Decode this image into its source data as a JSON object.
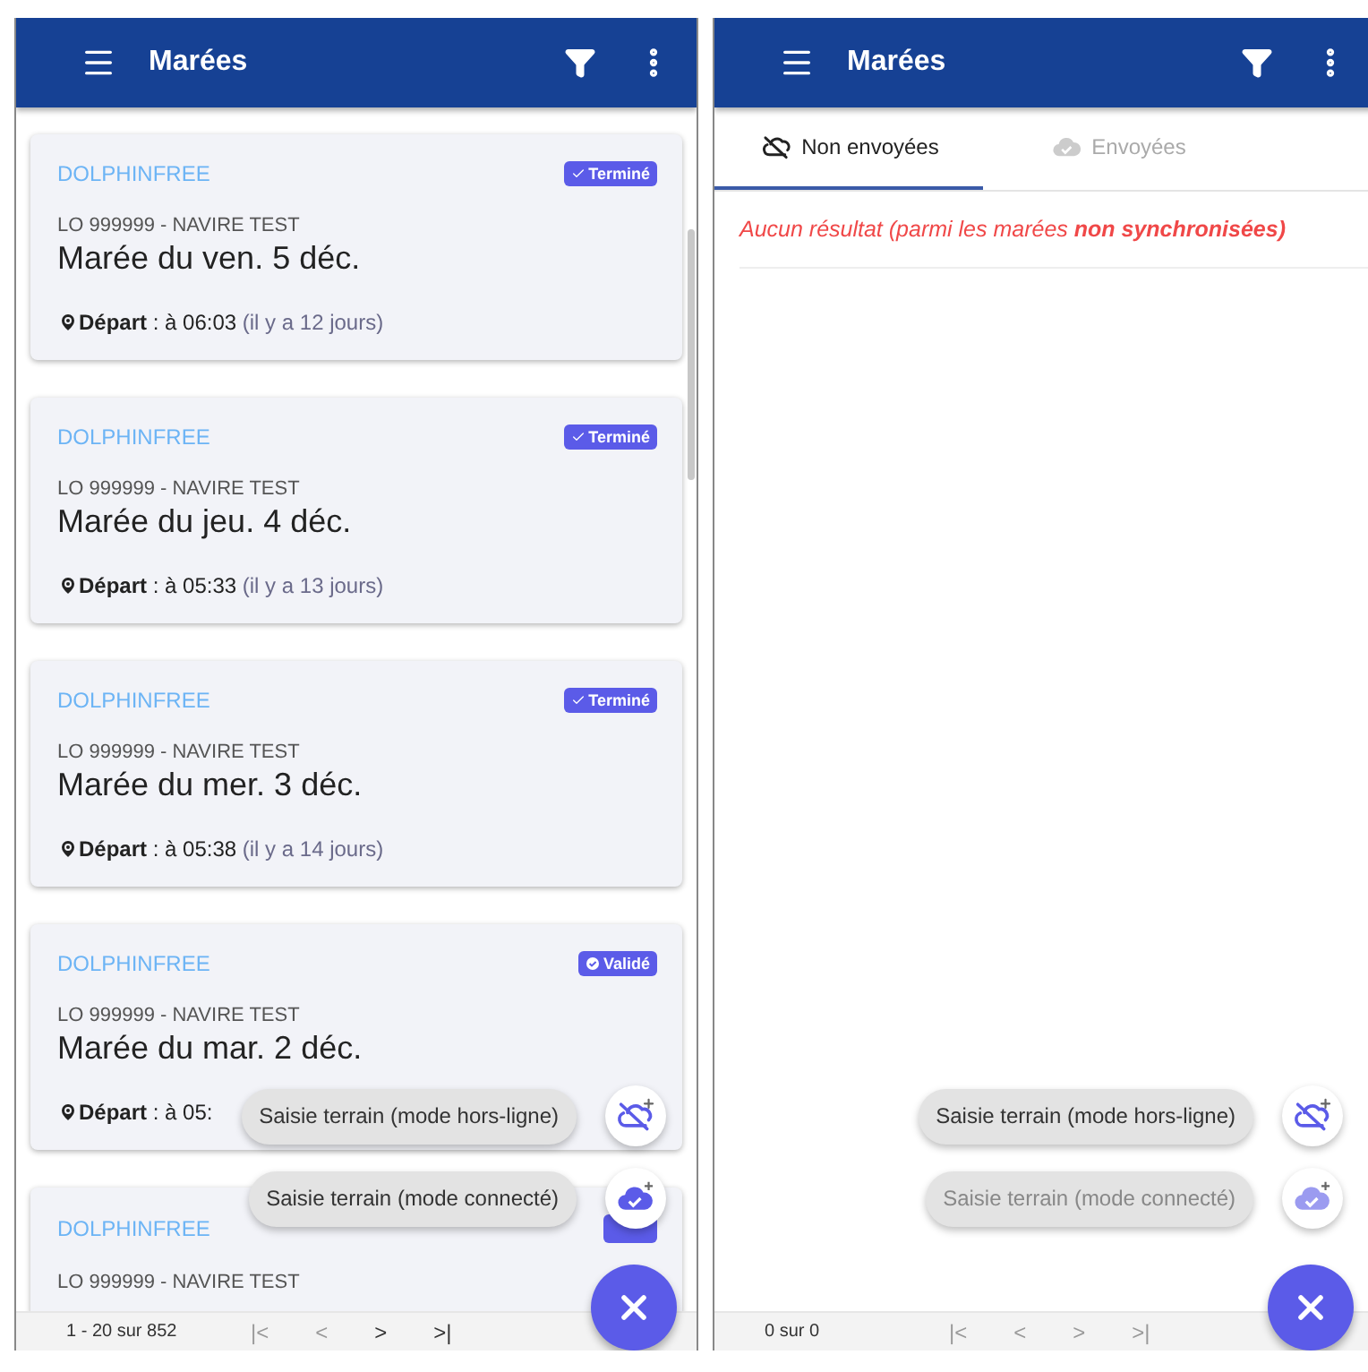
{
  "left_screen": {
    "app_bar": {
      "title": "Marées"
    },
    "trips": [
      {
        "organisation": "DOLPHINFREE",
        "status": {
          "kind": "done",
          "label": "Terminé"
        },
        "vessel": "LO 999999 - NAVIRE TEST",
        "title": "Marée du ven. 5 déc.",
        "departure": {
          "label": "Départ",
          "time": " : à 06:03",
          "ago": " (il y a 12 jours)"
        }
      },
      {
        "organisation": "DOLPHINFREE",
        "status": {
          "kind": "done",
          "label": "Terminé"
        },
        "vessel": "LO 999999 - NAVIRE TEST",
        "title": "Marée du jeu. 4 déc.",
        "departure": {
          "label": "Départ",
          "time": " : à 05:33",
          "ago": " (il y a 13 jours)"
        }
      },
      {
        "organisation": "DOLPHINFREE",
        "status": {
          "kind": "done",
          "label": "Terminé"
        },
        "vessel": "LO 999999 - NAVIRE TEST",
        "title": "Marée du mer. 3 déc.",
        "departure": {
          "label": "Départ",
          "time": " : à 05:38",
          "ago": " (il y a 14 jours)"
        }
      },
      {
        "organisation": "DOLPHINFREE",
        "status": {
          "kind": "validated",
          "label": "Validé"
        },
        "vessel": "LO 999999 - NAVIRE TEST",
        "title": "Marée du mar. 2 déc.",
        "departure": {
          "label": "Départ",
          "time": " : à 05:"
        }
      },
      {
        "organisation": "DOLPHINFREE",
        "vessel": "LO 999999 - NAVIRE TEST"
      }
    ],
    "speed_dial": [
      {
        "kind": "offline",
        "label": "Saisie terrain (mode hors-ligne)",
        "disabled": false
      },
      {
        "kind": "online",
        "label": "Saisie terrain (mode connecté)",
        "disabled": false
      }
    ],
    "paginator": {
      "range": "1 - 20 sur 852",
      "buttons": [
        {
          "label": "|<",
          "disabled": true
        },
        {
          "label": "<",
          "disabled": true
        },
        {
          "label": ">",
          "disabled": false
        },
        {
          "label": ">|",
          "disabled": false
        }
      ]
    }
  },
  "right_screen": {
    "app_bar": {
      "title": "Marées"
    },
    "tabs": [
      {
        "kind": "offline",
        "label": "Non envoyées",
        "selected": true
      },
      {
        "kind": "online",
        "label": "Envoyées",
        "selected": false
      }
    ],
    "empty_message": "Aucun résultat (parmi les marées **non synchronisées)**",
    "speed_dial": [
      {
        "kind": "offline",
        "label": "Saisie terrain (mode hors-ligne)",
        "disabled": false
      },
      {
        "kind": "online",
        "label": "Saisie terrain (mode connecté)",
        "disabled": true
      }
    ],
    "paginator": {
      "range": "0 sur 0",
      "buttons": [
        {
          "label": "|<",
          "disabled": true
        },
        {
          "label": "<",
          "disabled": true
        },
        {
          "label": ">",
          "disabled": true
        },
        {
          "label": ">|",
          "disabled": true
        }
      ]
    }
  }
}
